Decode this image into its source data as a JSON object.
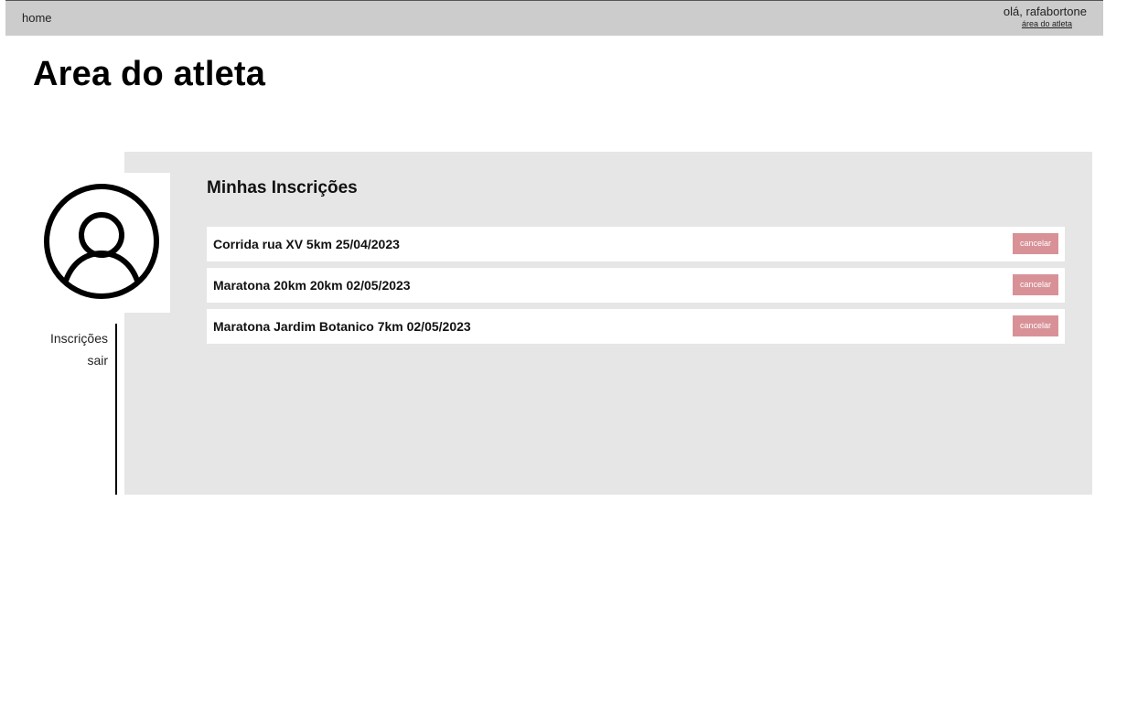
{
  "header": {
    "home_label": "home",
    "greeting": "olá, rafabortone",
    "area_link_label": "área do atleta"
  },
  "page": {
    "title": "Area do atleta"
  },
  "profile": {
    "avatar_icon": "user-circle-icon"
  },
  "sidebar": {
    "items": [
      {
        "label": "Inscrições"
      },
      {
        "label": "sair"
      }
    ]
  },
  "registrations": {
    "title": "Minhas Inscrições",
    "items": [
      {
        "text": "Corrida rua XV 5km 25/04/2023",
        "action_label": "cancelar"
      },
      {
        "text": "Maratona 20km 20km 02/05/2023",
        "action_label": "cancelar"
      },
      {
        "text": "Maratona Jardim Botanico 7km 02/05/2023",
        "action_label": "cancelar"
      }
    ]
  },
  "colors": {
    "topbar": "#cccccc",
    "panel": "#e6e6e6",
    "cancel_button": "#d89297"
  }
}
